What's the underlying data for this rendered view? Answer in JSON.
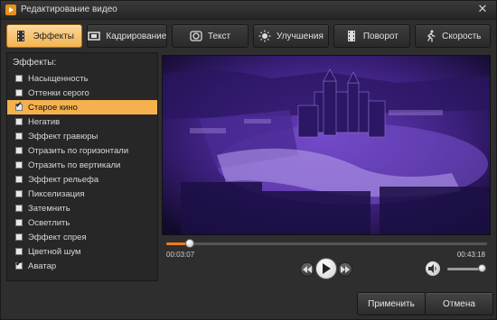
{
  "window": {
    "title": "Редактирование видео",
    "close_glyph": "✕"
  },
  "tabs": [
    {
      "label": "Эффекты",
      "icon": "film-frame-icon",
      "active": true
    },
    {
      "label": "Кадрирование",
      "icon": "crop-film-icon",
      "active": false
    },
    {
      "label": "Текст",
      "icon": "text-circle-icon",
      "active": false
    },
    {
      "label": "Улучшения",
      "icon": "sun-enhance-icon",
      "active": false
    },
    {
      "label": "Поворот",
      "icon": "rotate-film-icon",
      "active": false
    },
    {
      "label": "Скорость",
      "icon": "running-man-icon",
      "active": false
    }
  ],
  "effects": {
    "label": "Эффекты:",
    "items": [
      {
        "label": "Насыщенность",
        "checked": false,
        "selected": false
      },
      {
        "label": "Оттенки серого",
        "checked": false,
        "selected": false
      },
      {
        "label": "Старое кино",
        "checked": true,
        "selected": true
      },
      {
        "label": "Негатив",
        "checked": false,
        "selected": false
      },
      {
        "label": "Эффект гравюры",
        "checked": false,
        "selected": false
      },
      {
        "label": "Отразить по горизонтали",
        "checked": false,
        "selected": false
      },
      {
        "label": "Отразить по вертикали",
        "checked": false,
        "selected": false
      },
      {
        "label": "Эффект рельефа",
        "checked": false,
        "selected": false
      },
      {
        "label": "Пикселизация",
        "checked": false,
        "selected": false
      },
      {
        "label": "Затемнить",
        "checked": false,
        "selected": false
      },
      {
        "label": "Осветлить",
        "checked": false,
        "selected": false
      },
      {
        "label": "Эффект спрея",
        "checked": false,
        "selected": false
      },
      {
        "label": "Цветной шум",
        "checked": false,
        "selected": false
      },
      {
        "label": "Аватар",
        "checked": true,
        "selected": false
      }
    ]
  },
  "player": {
    "current_time": "00:03:07",
    "total_time": "00:43:18",
    "progress_fraction": 0.072,
    "volume_fraction": 0.95
  },
  "buttons": {
    "apply": "Применить",
    "cancel": "Отмена"
  },
  "colors": {
    "accent": "#f4b14e",
    "progress": "#f07a1c",
    "tint": "#5a2ea0"
  }
}
